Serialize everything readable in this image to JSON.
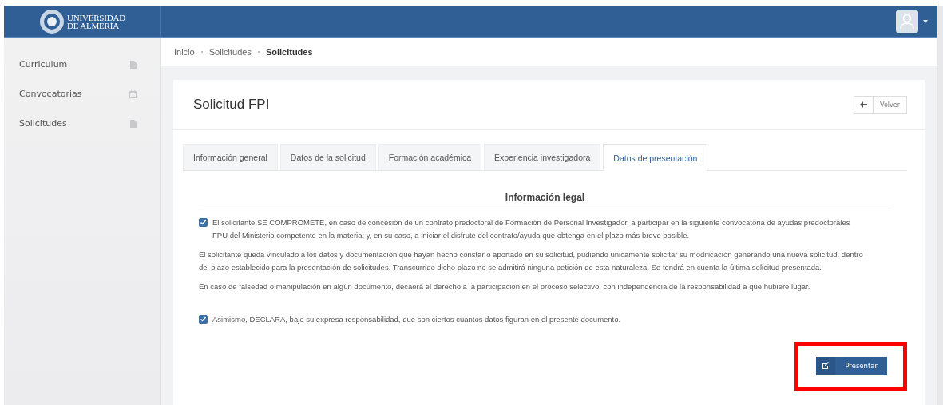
{
  "header": {
    "logo_lines": [
      "UNIVERSIDAD",
      "DE ALMERÍA"
    ]
  },
  "sidebar": {
    "items": [
      {
        "label": "Curriculum",
        "kind": "file"
      },
      {
        "label": "Convocatorias",
        "kind": "calendar"
      },
      {
        "label": "Solicitudes",
        "kind": "file"
      }
    ]
  },
  "breadcrumb": [
    {
      "label": "Inicio",
      "current": false
    },
    {
      "label": "Solicitudes",
      "current": false
    },
    {
      "label": "Solicitudes",
      "current": true
    }
  ],
  "page": {
    "title": "Solicitud FPI",
    "back_button": "Volver"
  },
  "tabs": [
    {
      "label": "Información general",
      "selected": false
    },
    {
      "label": "Datos de la solicitud",
      "selected": false
    },
    {
      "label": "Formación académica",
      "selected": false
    },
    {
      "label": "Experiencia investigadora",
      "selected": false
    },
    {
      "label": "Datos de presentación",
      "selected": true
    }
  ],
  "section_title": "Información legal",
  "items": [
    {
      "kind": "checkbox",
      "checked": true,
      "text": "El solicitante SE COMPROMETE, en caso de concesión de un contrato predoctoral de Formación de Personal Investigador, a participar en la siguiente convocatoria de ayudas predoctorales FPU del Ministerio competente en la materia; y, en su caso, a iniciar el disfrute del contrato/ayuda que obtenga en el plazo más breve posible."
    },
    {
      "kind": "paragraph",
      "text": "El solicitante queda vinculado a los datos y documentación que hayan hecho constar o aportado en su solicitud, pudiendo únicamente solicitar su modificación generando una nueva solicitud, dentro del plazo establecido para la presentación de solicitudes. Transcurrido dicho plazo no se admitirá ninguna petición de esta naturaleza. Se tendrá en cuenta la última solicitud presentada."
    },
    {
      "kind": "paragraph",
      "text": "En caso de falsedad o manipulación en algún documento, decaerá el derecho a la participación en el proceso selectivo, con independencia de la responsabilidad a que hubiere lugar."
    },
    {
      "kind": "checkbox",
      "checked": true,
      "text": "Asimismo, DECLARA, bajo su expresa responsabilidad, que son ciertos cuantos datos figuran en el presente documento."
    }
  ],
  "submit": {
    "label": "Presentar",
    "highlighted": true
  }
}
